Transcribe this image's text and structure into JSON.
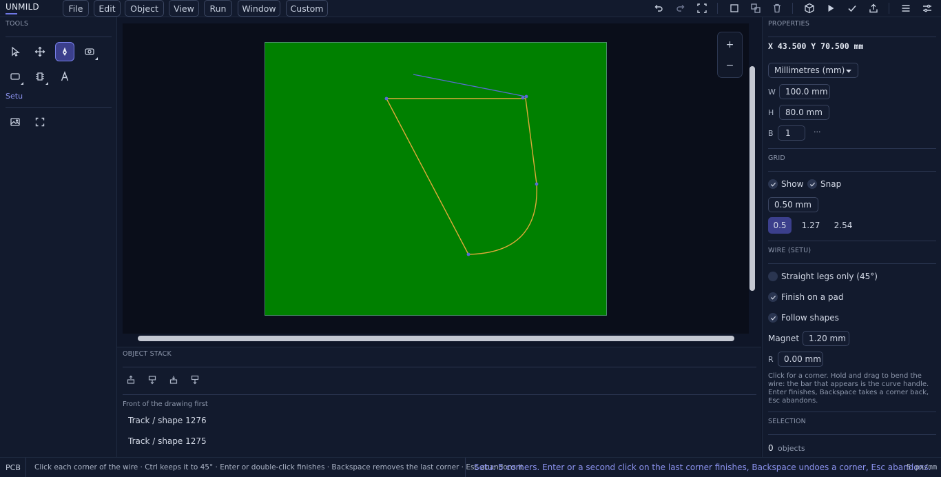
{
  "app": {
    "title": "UNMILD"
  },
  "menu": [
    "File",
    "Edit",
    "Object",
    "View",
    "Run",
    "Window",
    "Custom"
  ],
  "toolbar_icons": [
    "undo-icon",
    "redo-icon",
    "fit-view-icon",
    "frame-icon",
    "group-icon",
    "delete-icon",
    "3d-view-icon",
    "run-icon",
    "check-icon",
    "export-icon",
    "menu-icon",
    "settings-sliders-icon"
  ],
  "left_panel": {
    "heading": "TOOLS",
    "tools": [
      "select-tool-icon",
      "move-tool-icon",
      "pen-tool-icon",
      "via-tool-icon",
      "rectangle-tool-icon",
      "component-tool-icon",
      "text-tool-icon",
      "image-tool-icon",
      "fit-frame-tool-icon"
    ],
    "active_tool_label": "Setu"
  },
  "canvas": {
    "board_color": "#008000",
    "wire_color": "#e0a93a",
    "guide_color": "#5a6bd6",
    "zoom_in": "+",
    "zoom_out": "−"
  },
  "object_stack": {
    "heading": "OBJECT STACK",
    "subheading": "Front of the drawing first",
    "items": [
      "Track / shape 1276",
      "Track / shape 1275"
    ]
  },
  "properties": {
    "heading": "PROPERTIES",
    "coords": "X 43.500  Y 70.500 mm",
    "units": "Millimetres (mm)",
    "w_label": "W",
    "w_value": "100.0 mm",
    "h_label": "H",
    "h_value": "80.0 mm",
    "b_label": "B",
    "b_value": "1",
    "b_more": "···"
  },
  "grid": {
    "heading": "GRID",
    "show_label": "Show",
    "show_checked": true,
    "snap_label": "Snap",
    "snap_checked": true,
    "size": "0.50 mm",
    "presets": [
      "0.5",
      "1.27",
      "2.54"
    ],
    "selected_preset": "0.5"
  },
  "wire": {
    "heading": "WIRE (SETU)",
    "straight_label": "Straight legs only (45°)",
    "straight_checked": false,
    "finish_label": "Finish on a pad",
    "finish_checked": true,
    "follow_label": "Follow shapes",
    "follow_checked": true,
    "magnet_label": "Magnet",
    "magnet_value": "1.20 mm",
    "r_label": "R",
    "r_value": "0.00 mm",
    "hint": "Click for a corner. Hold and drag to bend the wire: the bar that appears is the curve handle. Enter finishes, Backspace takes a corner back, Esc abandons."
  },
  "selection": {
    "heading": "SELECTION",
    "count": "0",
    "unit": "objects"
  },
  "status": {
    "mode": "PCB",
    "hint": "Click each corner of the wire · Ctrl keeps it to 45° · Enter or double-click finishes · Backspace removes the last corner · Esc abandons it",
    "live": "Setu: 5 corners. Enter or a second click on the last corner finishes, Backspace undoes a corner, Esc abandons.",
    "zoom": "5 px/mm"
  }
}
